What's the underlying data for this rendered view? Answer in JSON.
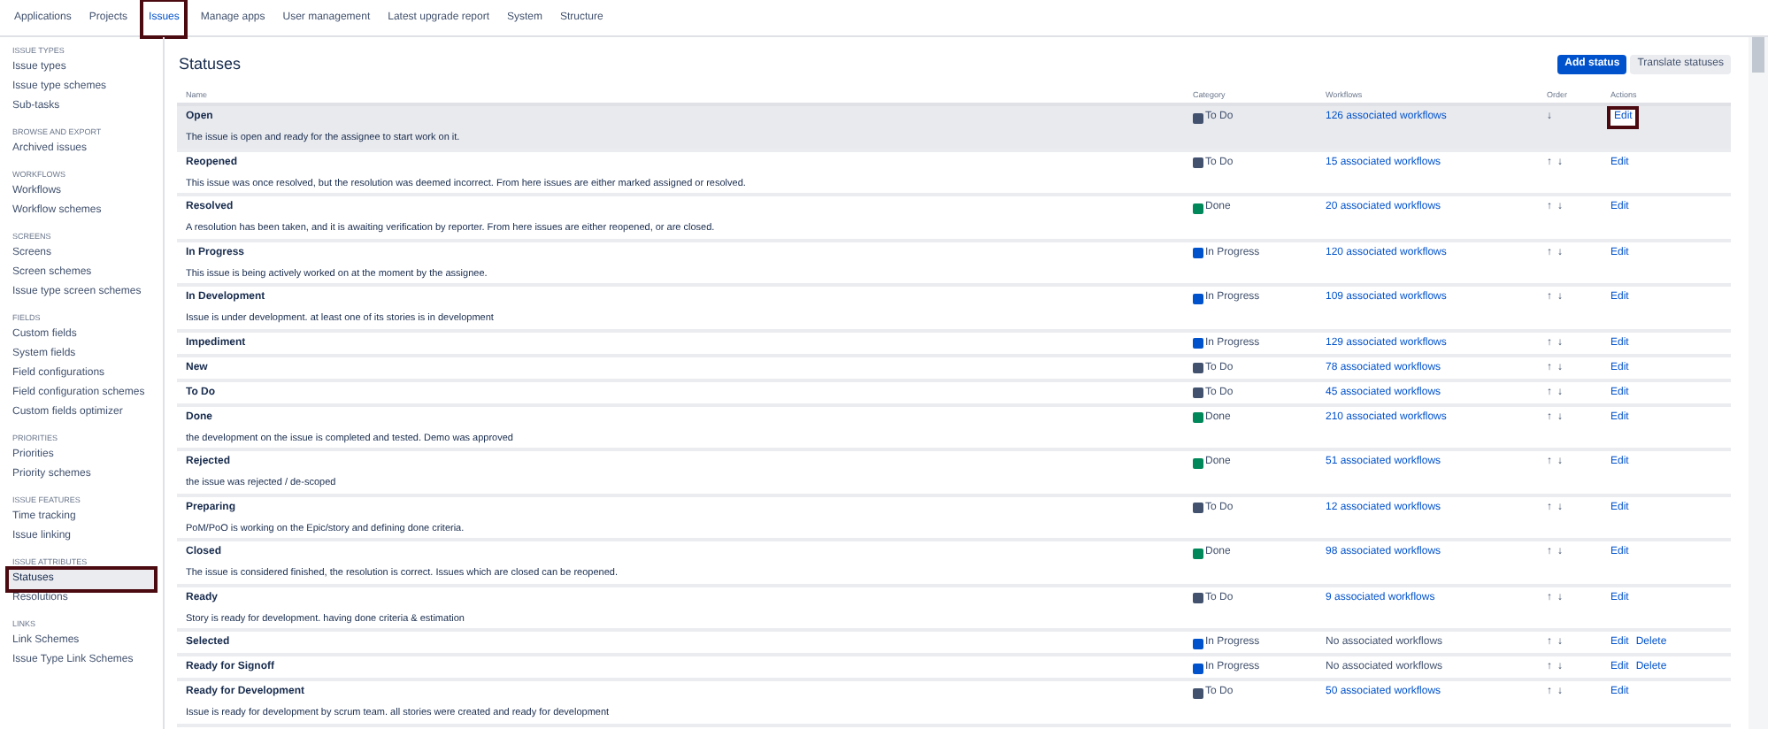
{
  "nav": [
    {
      "label": "Applications",
      "selected": false,
      "highlighted": false
    },
    {
      "label": "Projects",
      "selected": false,
      "highlighted": false
    },
    {
      "label": "Issues",
      "selected": true,
      "highlighted": true
    },
    {
      "label": "Manage apps",
      "selected": false,
      "highlighted": false
    },
    {
      "label": "User management",
      "selected": false,
      "highlighted": false
    },
    {
      "label": "Latest upgrade report",
      "selected": false,
      "highlighted": false
    },
    {
      "label": "System",
      "selected": false,
      "highlighted": false
    },
    {
      "label": "Structure",
      "selected": false,
      "highlighted": false
    }
  ],
  "sidebar": [
    {
      "heading": "ISSUE TYPES",
      "items": [
        {
          "label": "Issue types",
          "selected": false,
          "highlighted": false
        },
        {
          "label": "Issue type schemes",
          "selected": false,
          "highlighted": false
        },
        {
          "label": "Sub-tasks",
          "selected": false,
          "highlighted": false
        }
      ]
    },
    {
      "heading": "BROWSE AND EXPORT",
      "items": [
        {
          "label": "Archived issues",
          "selected": false,
          "highlighted": false
        }
      ]
    },
    {
      "heading": "WORKFLOWS",
      "items": [
        {
          "label": "Workflows",
          "selected": false,
          "highlighted": false
        },
        {
          "label": "Workflow schemes",
          "selected": false,
          "highlighted": false
        }
      ]
    },
    {
      "heading": "SCREENS",
      "items": [
        {
          "label": "Screens",
          "selected": false,
          "highlighted": false
        },
        {
          "label": "Screen schemes",
          "selected": false,
          "highlighted": false
        },
        {
          "label": "Issue type screen schemes",
          "selected": false,
          "highlighted": false
        }
      ]
    },
    {
      "heading": "FIELDS",
      "items": [
        {
          "label": "Custom fields",
          "selected": false,
          "highlighted": false
        },
        {
          "label": "System fields",
          "selected": false,
          "highlighted": false
        },
        {
          "label": "Field configurations",
          "selected": false,
          "highlighted": false
        },
        {
          "label": "Field configuration schemes",
          "selected": false,
          "highlighted": false
        },
        {
          "label": "Custom fields optimizer",
          "selected": false,
          "highlighted": false
        }
      ]
    },
    {
      "heading": "PRIORITIES",
      "items": [
        {
          "label": "Priorities",
          "selected": false,
          "highlighted": false
        },
        {
          "label": "Priority schemes",
          "selected": false,
          "highlighted": false
        }
      ]
    },
    {
      "heading": "ISSUE FEATURES",
      "items": [
        {
          "label": "Time tracking",
          "selected": false,
          "highlighted": false
        },
        {
          "label": "Issue linking",
          "selected": false,
          "highlighted": false
        }
      ]
    },
    {
      "heading": "ISSUE ATTRIBUTES",
      "items": [
        {
          "label": "Statuses",
          "selected": true,
          "highlighted": true
        },
        {
          "label": "Resolutions",
          "selected": false,
          "highlighted": false
        }
      ]
    },
    {
      "heading": "LINKS",
      "items": [
        {
          "label": "Link Schemes",
          "selected": false,
          "highlighted": false
        },
        {
          "label": "Issue Type Link Schemes",
          "selected": false,
          "highlighted": false
        }
      ]
    }
  ],
  "page_title": "Statuses",
  "buttons": [
    {
      "label": "Add status",
      "kind": "primary"
    },
    {
      "label": "Translate statuses",
      "kind": "secondary"
    }
  ],
  "table": {
    "columns": [
      "Name",
      "Category",
      "Workflows",
      "Order",
      "Actions"
    ],
    "rows": [
      {
        "name": "Open",
        "description": "The issue is open and ready for the assignee to start work on it.",
        "category": "To Do",
        "color": "#42526e",
        "workflows": "126 associated workflows",
        "linked": true,
        "order": [
          "↓"
        ],
        "actions": [
          {
            "label": "Edit",
            "highlighted": true
          }
        ],
        "hovered": true
      },
      {
        "name": "Reopened",
        "description": "This issue was once resolved, but the resolution was deemed incorrect. From here issues are either marked assigned or resolved.",
        "category": "To Do",
        "color": "#42526e",
        "workflows": "15 associated workflows",
        "linked": true,
        "order": [
          "↑",
          "↓"
        ],
        "actions": [
          {
            "label": "Edit",
            "highlighted": false
          }
        ],
        "hovered": false
      },
      {
        "name": "Resolved",
        "description": "A resolution has been taken, and it is awaiting verification by reporter. From here issues are either reopened, or are closed.",
        "category": "Done",
        "color": "#00875a",
        "workflows": "20 associated workflows",
        "linked": true,
        "order": [
          "↑",
          "↓"
        ],
        "actions": [
          {
            "label": "Edit",
            "highlighted": false
          }
        ],
        "hovered": false
      },
      {
        "name": "In Progress",
        "description": "This issue is being actively worked on at the moment by the assignee.",
        "category": "In Progress",
        "color": "#0052cc",
        "workflows": "120 associated workflows",
        "linked": true,
        "order": [
          "↑",
          "↓"
        ],
        "actions": [
          {
            "label": "Edit",
            "highlighted": false
          }
        ],
        "hovered": false
      },
      {
        "name": "In Development",
        "description": "Issue is under development. at least one of its stories is in development",
        "category": "In Progress",
        "color": "#0052cc",
        "workflows": "109 associated workflows",
        "linked": true,
        "order": [
          "↑",
          "↓"
        ],
        "actions": [
          {
            "label": "Edit",
            "highlighted": false
          }
        ],
        "hovered": false
      },
      {
        "name": "Impediment",
        "category": "In Progress",
        "color": "#0052cc",
        "workflows": "129 associated workflows",
        "linked": true,
        "order": [
          "↑",
          "↓"
        ],
        "actions": [
          {
            "label": "Edit",
            "highlighted": false
          }
        ],
        "hovered": false
      },
      {
        "name": "New",
        "category": "To Do",
        "color": "#42526e",
        "workflows": "78 associated workflows",
        "linked": true,
        "order": [
          "↑",
          "↓"
        ],
        "actions": [
          {
            "label": "Edit",
            "highlighted": false
          }
        ],
        "hovered": false
      },
      {
        "name": "To Do",
        "category": "To Do",
        "color": "#42526e",
        "workflows": "45 associated workflows",
        "linked": true,
        "order": [
          "↑",
          "↓"
        ],
        "actions": [
          {
            "label": "Edit",
            "highlighted": false
          }
        ],
        "hovered": false
      },
      {
        "name": "Done",
        "description": "the development on the issue is completed and tested. Demo was approved",
        "category": "Done",
        "color": "#00875a",
        "workflows": "210 associated workflows",
        "linked": true,
        "order": [
          "↑",
          "↓"
        ],
        "actions": [
          {
            "label": "Edit",
            "highlighted": false
          }
        ],
        "hovered": false
      },
      {
        "name": "Rejected",
        "description": "the issue was rejected / de-scoped",
        "category": "Done",
        "color": "#00875a",
        "workflows": "51 associated workflows",
        "linked": true,
        "order": [
          "↑",
          "↓"
        ],
        "actions": [
          {
            "label": "Edit",
            "highlighted": false
          }
        ],
        "hovered": false
      },
      {
        "name": "Preparing",
        "description": "PoM/PoO is working on the Epic/story and defining done criteria.",
        "category": "To Do",
        "color": "#42526e",
        "workflows": "12 associated workflows",
        "linked": true,
        "order": [
          "↑",
          "↓"
        ],
        "actions": [
          {
            "label": "Edit",
            "highlighted": false
          }
        ],
        "hovered": false
      },
      {
        "name": "Closed",
        "description": "The issue is considered finished, the resolution is correct. Issues which are closed can be reopened.",
        "category": "Done",
        "color": "#00875a",
        "workflows": "98 associated workflows",
        "linked": true,
        "order": [
          "↑",
          "↓"
        ],
        "actions": [
          {
            "label": "Edit",
            "highlighted": false
          }
        ],
        "hovered": false
      },
      {
        "name": "Ready",
        "description": "Story is ready for development. having done criteria & estimation",
        "category": "To Do",
        "color": "#42526e",
        "workflows": "9 associated workflows",
        "linked": true,
        "order": [
          "↑",
          "↓"
        ],
        "actions": [
          {
            "label": "Edit",
            "highlighted": false
          }
        ],
        "hovered": false
      },
      {
        "name": "Selected",
        "category": "In Progress",
        "color": "#0052cc",
        "workflows": "No associated workflows",
        "linked": false,
        "order": [
          "↑",
          "↓"
        ],
        "actions": [
          {
            "label": "Edit",
            "highlighted": false
          },
          {
            "label": "Delete",
            "highlighted": false
          }
        ],
        "hovered": false
      },
      {
        "name": "Ready for Signoff",
        "category": "In Progress",
        "color": "#0052cc",
        "workflows": "No associated workflows",
        "linked": false,
        "order": [
          "↑",
          "↓"
        ],
        "actions": [
          {
            "label": "Edit",
            "highlighted": false
          },
          {
            "label": "Delete",
            "highlighted": false
          }
        ],
        "hovered": false
      },
      {
        "name": "Ready for Development",
        "description": "Issue is ready for development by scrum team. all stories were created and ready for development",
        "category": "To Do",
        "color": "#42526e",
        "workflows": "50 associated workflows",
        "linked": true,
        "order": [
          "↑",
          "↓"
        ],
        "actions": [
          {
            "label": "Edit",
            "highlighted": false
          }
        ],
        "hovered": false
      }
    ]
  }
}
